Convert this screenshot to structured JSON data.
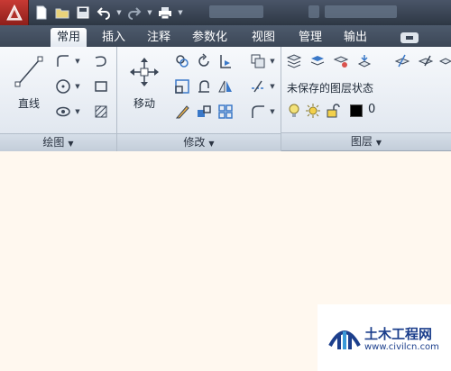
{
  "tabs": [
    {
      "label": "常用",
      "active": true
    },
    {
      "label": "插入",
      "active": false
    },
    {
      "label": "注释",
      "active": false
    },
    {
      "label": "参数化",
      "active": false
    },
    {
      "label": "视图",
      "active": false
    },
    {
      "label": "管理",
      "active": false
    },
    {
      "label": "输出",
      "active": false
    }
  ],
  "panels": {
    "draw": {
      "title": "绘图",
      "line_label": "直线"
    },
    "modify": {
      "title": "修改",
      "move_label": "移动"
    },
    "layers": {
      "title": "图层",
      "state": "未保存的图层状态",
      "current_layer": "0"
    }
  },
  "watermark": {
    "title": "土木工程网",
    "url": "www.civilcn.com"
  },
  "colors": {
    "title_bar": "#3c4757",
    "active_tab": "#e3e9f1",
    "canvas": "#fff8ef",
    "app_button": "#b0302a"
  },
  "icons": [
    "new-icon",
    "open-icon",
    "save-icon",
    "undo-icon",
    "redo-icon",
    "plot-icon",
    "line-icon",
    "polyline-icon",
    "circle-icon",
    "arc-icon",
    "rectangle-icon",
    "hatch-icon",
    "move-icon",
    "copy-icon",
    "rotate-icon",
    "trim-icon",
    "mirror-icon",
    "fillet-icon",
    "stretch-icon",
    "scale-icon",
    "array-icon",
    "offset-icon",
    "erase-icon",
    "explode-icon",
    "layer-properties-icon",
    "lightbulb-icon",
    "sun-icon",
    "lock-icon"
  ]
}
